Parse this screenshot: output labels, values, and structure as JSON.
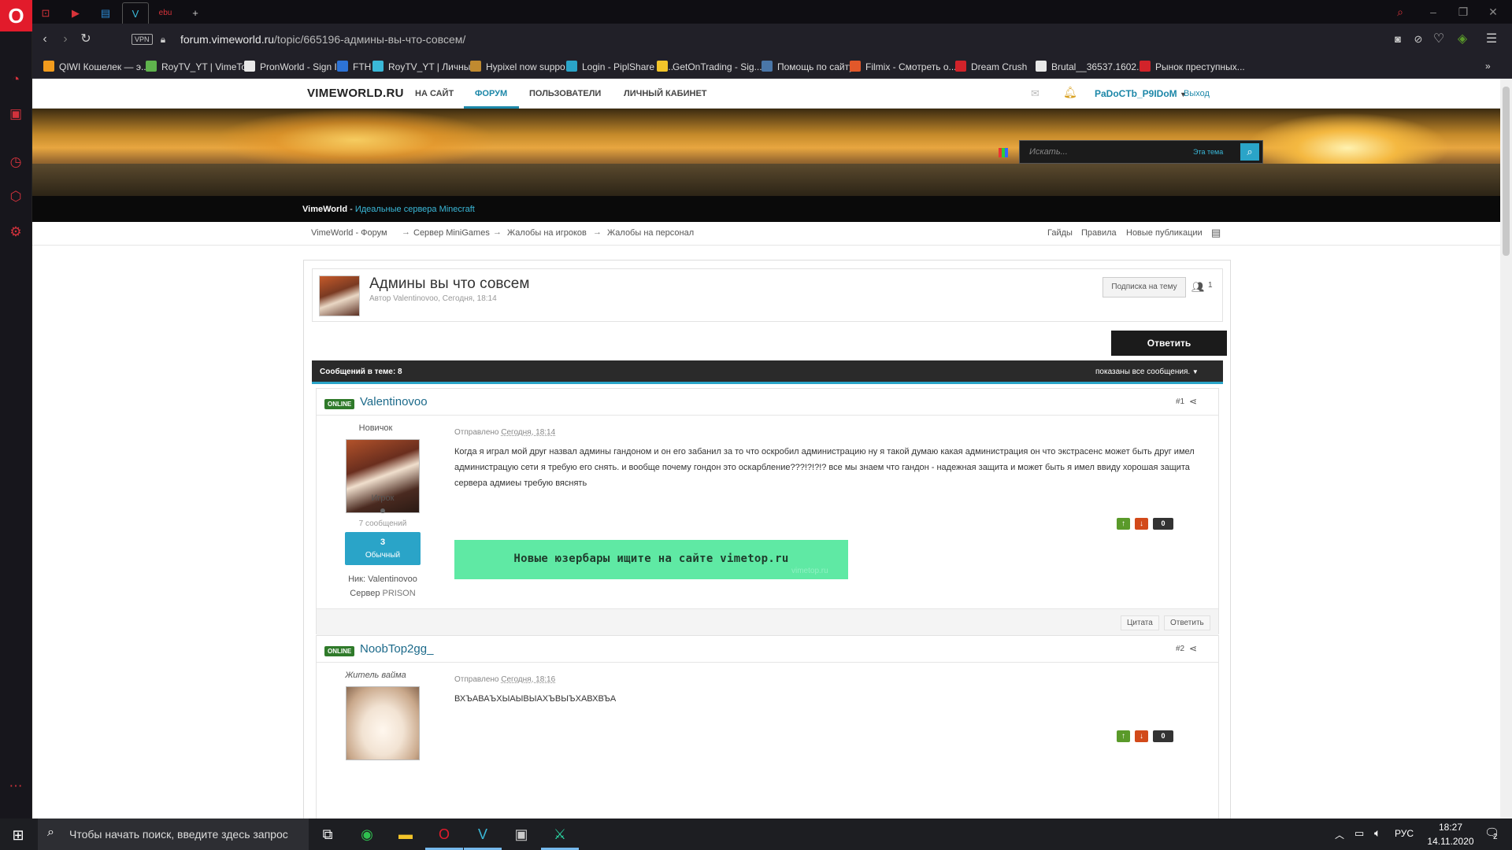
{
  "browser": {
    "url_host": "forum.vimeworld.ru",
    "url_path": "/topic/665196-админы-вы-что-совсем/",
    "vpn_label": "VPN",
    "tabs": [
      {
        "icon": "youtube-gaming-icon"
      },
      {
        "icon": "youtube-icon"
      },
      {
        "icon": "messenger-icon"
      },
      {
        "icon": "vimeworld-icon",
        "active": true
      },
      {
        "icon": "opera-link-icon"
      }
    ],
    "bookmarks": [
      {
        "label": "QIWI Кошелек — э...",
        "color": "#f29b1d"
      },
      {
        "label": "RoyTV_YT | VimeTo...",
        "color": "#5fb34d"
      },
      {
        "label": "PronWorld - Sign In",
        "color": "#e8e8e8"
      },
      {
        "label": "FTH",
        "color": "#2d73d6"
      },
      {
        "label": "RoyTV_YT | Личны...",
        "color": "#3ab8d8"
      },
      {
        "label": "Hypixel now suppo...",
        "color": "#c08a30"
      },
      {
        "label": "Login - PiplShare W...",
        "color": "#2aa4c8"
      },
      {
        "label": "GetOnTrading - Sig...",
        "color": "#f2c42a"
      },
      {
        "label": "Помощь по сайту",
        "color": "#4a76a8"
      },
      {
        "label": "Filmix - Смотреть о...",
        "color": "#e2582a"
      },
      {
        "label": "Dream Crush",
        "color": "#d2232a"
      },
      {
        "label": "Brutal__36537.1602...",
        "color": "#e8e8e8"
      },
      {
        "label": "Рынок преступных...",
        "color": "#d2232a"
      }
    ]
  },
  "site": {
    "logo": "VIMEWORLD.RU",
    "nav": [
      "НА САЙТ",
      "ФОРУМ",
      "ПОЛЬЗОВАТЕЛИ",
      "ЛИЧНЫЙ КАБИНЕТ"
    ],
    "active_nav": "ФОРУМ",
    "username": "PaDoCTb_P9IDoM",
    "logout": "Выход",
    "search_placeholder": "Искать...",
    "search_scope": "Эта тема",
    "tagline_brand": "VimeWorld",
    "tagline_sep": " - ",
    "tagline_text": "Идеальные сервера Minecraft"
  },
  "breadcrumb": [
    "VimeWorld - Форум",
    "Сервер MiniGames",
    "Жалобы на игроков",
    "Жалобы на персонал"
  ],
  "breadcrumb_sep": "→",
  "quick_links": [
    "Гайды",
    "Правила",
    "Новые публикации"
  ],
  "topic": {
    "title": "Админы вы что совсем",
    "meta": "Автор Valentinovoo, Сегодня, 18:14",
    "subscribe_label": "Подписка на тему",
    "followers": "1",
    "reply_label": "Ответить",
    "posts_count_label": "Сообщений в теме: 8",
    "filter_label": "показаны все сообщения."
  },
  "posts": [
    {
      "badge": "ONLINE",
      "author": "Valentinovoo",
      "number": "#1",
      "rank_title": "Новичок",
      "group": "Игрок",
      "post_count": "7 сообщений",
      "rep_value": "3",
      "rep_label": "Обычный",
      "nick_label": "Ник: Valentinovoo",
      "server_prefix": "Сервер",
      "server_name": "PRISON",
      "sent_prefix": "Отправлено",
      "sent_time": "Сегодня, 18:14",
      "body": "Когда я играл мой друг назвал админы гандоном и он его забанил за то что  оскробил администрацию ну я такой думаю какая администрация он что экстрасенс может быть друг имел администрацую сети я требую его снять. и вообще почему гондон это оскарбление???!?!?!? все мы знаем что гандон - надежная защита и может быть я имел ввиду хорошая защита сервера адмиеы требую вяснять",
      "votes": "0",
      "userbar_text": "Новые юзербары ищите на сайте vimetop.ru",
      "userbar_mark": "vimetop.ru",
      "quote_label": "Цитата",
      "reply_label": "Ответить"
    },
    {
      "badge": "ONLINE",
      "author": "NoobTop2gg_",
      "number": "#2",
      "rank_title": "Житель вайма",
      "sent_prefix": "Отправлено",
      "sent_time": "Сегодня, 18:16",
      "body": "ВХЪАВАЪХЫАЫВЫАХЪВЫЪХАВХВЪА",
      "votes": "0"
    }
  ],
  "taskbar": {
    "search_text": "Чтобы начать поиск, введите здесь запрос",
    "lang": "РУС",
    "time": "18:27",
    "date": "14.11.2020",
    "notif_count": "2"
  }
}
